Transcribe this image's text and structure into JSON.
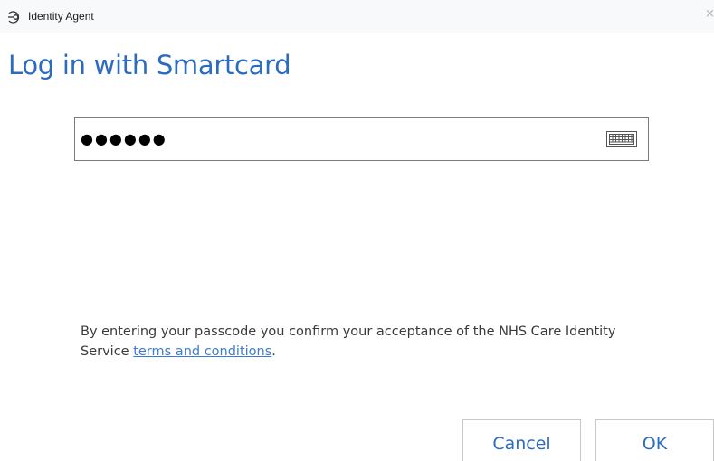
{
  "window": {
    "title": "Identity Agent",
    "close_glyph": "×"
  },
  "heading": "Log in with Smartcard",
  "passcode": {
    "masked_value": "●●●●●●",
    "keyboard_icon": "keyboard-icon"
  },
  "terms": {
    "text": "By entering your passcode you confirm your acceptance of the NHS Care Identity Service ",
    "link": "terms and conditions",
    "suffix": "."
  },
  "buttons": {
    "cancel": "Cancel",
    "ok": "OK"
  },
  "colors": {
    "accent": "#2b6cc0",
    "link": "#3b7cd0",
    "titlebar_bg": "#f8f9fb"
  }
}
